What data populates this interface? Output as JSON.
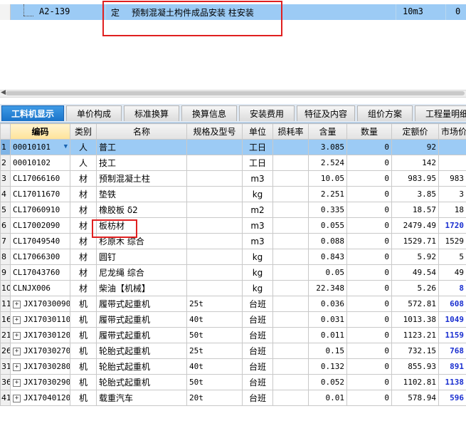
{
  "quota": {
    "code": "A2-139",
    "type": "定",
    "name": "预制混凝土构件成品安装 柱安装",
    "unit": "10m3",
    "quantity": "0"
  },
  "tabs": [
    {
      "label": "工料机显示",
      "active": true
    },
    {
      "label": "单价构成"
    },
    {
      "label": "标准换算"
    },
    {
      "label": "换算信息"
    },
    {
      "label": "安装费用"
    },
    {
      "label": "特征及内容"
    },
    {
      "label": "组价方案"
    },
    {
      "label": "工程量明细"
    }
  ],
  "grid": {
    "headers": [
      "",
      "编码",
      "类别",
      "名称",
      "规格及型号",
      "单位",
      "损耗率",
      "含量",
      "数量",
      "定额价",
      "市场价"
    ],
    "rows": [
      {
        "rn": "1",
        "code": "00010101",
        "cat": "人",
        "name": "普工",
        "spec": "",
        "unit": "工日",
        "loss": "",
        "content": "3.085",
        "qty": "0",
        "price": "92",
        "market": "",
        "selected": true,
        "dropdown": true
      },
      {
        "rn": "2",
        "code": "00010102",
        "cat": "人",
        "name": "技工",
        "spec": "",
        "unit": "工日",
        "loss": "",
        "content": "2.524",
        "qty": "0",
        "price": "142",
        "market": ""
      },
      {
        "rn": "3",
        "code": "CL17066160",
        "cat": "材",
        "name": "预制混凝土柱",
        "spec": "",
        "unit": "m3",
        "loss": "",
        "content": "10.05",
        "qty": "0",
        "price": "983.95",
        "market": "983"
      },
      {
        "rn": "4",
        "code": "CL17011670",
        "cat": "材",
        "name": "垫铁",
        "spec": "",
        "unit": "kg",
        "loss": "",
        "content": "2.251",
        "qty": "0",
        "price": "3.85",
        "market": "3"
      },
      {
        "rn": "5",
        "code": "CL17060910",
        "cat": "材",
        "name": "橡胶板 δ2",
        "spec": "",
        "unit": "m2",
        "loss": "",
        "content": "0.335",
        "qty": "0",
        "price": "18.57",
        "market": "18"
      },
      {
        "rn": "6",
        "code": "CL17002090",
        "cat": "材",
        "name": "板枋材",
        "spec": "",
        "unit": "m3",
        "loss": "",
        "content": "0.055",
        "qty": "0",
        "price": "2479.49",
        "market": "1720",
        "blue": true
      },
      {
        "rn": "7",
        "code": "CL17049540",
        "cat": "材",
        "name": "杉原木 综合",
        "spec": "",
        "unit": "m3",
        "loss": "",
        "content": "0.088",
        "qty": "0",
        "price": "1529.71",
        "market": "1529"
      },
      {
        "rn": "8",
        "code": "CL17066300",
        "cat": "材",
        "name": "圆钉",
        "spec": "",
        "unit": "kg",
        "loss": "",
        "content": "0.843",
        "qty": "0",
        "price": "5.92",
        "market": "5"
      },
      {
        "rn": "9",
        "code": "CL17043760",
        "cat": "材",
        "name": "尼龙绳 综合",
        "spec": "",
        "unit": "kg",
        "loss": "",
        "content": "0.05",
        "qty": "0",
        "price": "49.54",
        "market": "49"
      },
      {
        "rn": "10",
        "code": "CLNJX006",
        "cat": "材",
        "name": "柴油【机械】",
        "spec": "",
        "unit": "kg",
        "loss": "",
        "content": "22.348",
        "qty": "0",
        "price": "5.26",
        "market": "8",
        "blue": true
      },
      {
        "rn": "11",
        "code": "JX17030090",
        "cat": "机",
        "name": "履带式起重机",
        "spec": "25t",
        "unit": "台班",
        "loss": "",
        "content": "0.036",
        "qty": "0",
        "price": "572.81",
        "market": "608",
        "blue": true,
        "plus": true
      },
      {
        "rn": "16",
        "code": "JX17030110",
        "cat": "机",
        "name": "履带式起重机",
        "spec": "40t",
        "unit": "台班",
        "loss": "",
        "content": "0.031",
        "qty": "0",
        "price": "1013.38",
        "market": "1049",
        "blue": true,
        "plus": true
      },
      {
        "rn": "21",
        "code": "JX17030120",
        "cat": "机",
        "name": "履带式起重机",
        "spec": "50t",
        "unit": "台班",
        "loss": "",
        "content": "0.011",
        "qty": "0",
        "price": "1123.21",
        "market": "1159",
        "blue": true,
        "plus": true
      },
      {
        "rn": "26",
        "code": "JX17030270",
        "cat": "机",
        "name": "轮胎式起重机",
        "spec": "25t",
        "unit": "台班",
        "loss": "",
        "content": "0.15",
        "qty": "0",
        "price": "732.15",
        "market": "768",
        "blue": true,
        "plus": true
      },
      {
        "rn": "31",
        "code": "JX17030280",
        "cat": "机",
        "name": "轮胎式起重机",
        "spec": "40t",
        "unit": "台班",
        "loss": "",
        "content": "0.132",
        "qty": "0",
        "price": "855.93",
        "market": "891",
        "blue": true,
        "plus": true
      },
      {
        "rn": "36",
        "code": "JX17030290",
        "cat": "机",
        "name": "轮胎式起重机",
        "spec": "50t",
        "unit": "台班",
        "loss": "",
        "content": "0.052",
        "qty": "0",
        "price": "1102.81",
        "market": "1138",
        "blue": true,
        "plus": true
      },
      {
        "rn": "41",
        "code": "JX17040120",
        "cat": "机",
        "name": "载重汽车",
        "spec": "20t",
        "unit": "台班",
        "loss": "",
        "content": "0.01",
        "qty": "0",
        "price": "578.94",
        "market": "596",
        "blue": true,
        "plus": true
      }
    ]
  },
  "icons": {
    "expand": "plus-box-icon",
    "dropdown": "dropdown-arrow-icon",
    "scroll": "scroll-left-arrow-icon"
  },
  "glyphs": {
    "plus": "+",
    "dropdown": "▼",
    "scroll_left": "◀"
  },
  "colors": {
    "selection": "#9ccbf5",
    "active_tab": "#1a73c9",
    "market_price_blue": "#1a2fd0",
    "highlight": "#e02020"
  }
}
